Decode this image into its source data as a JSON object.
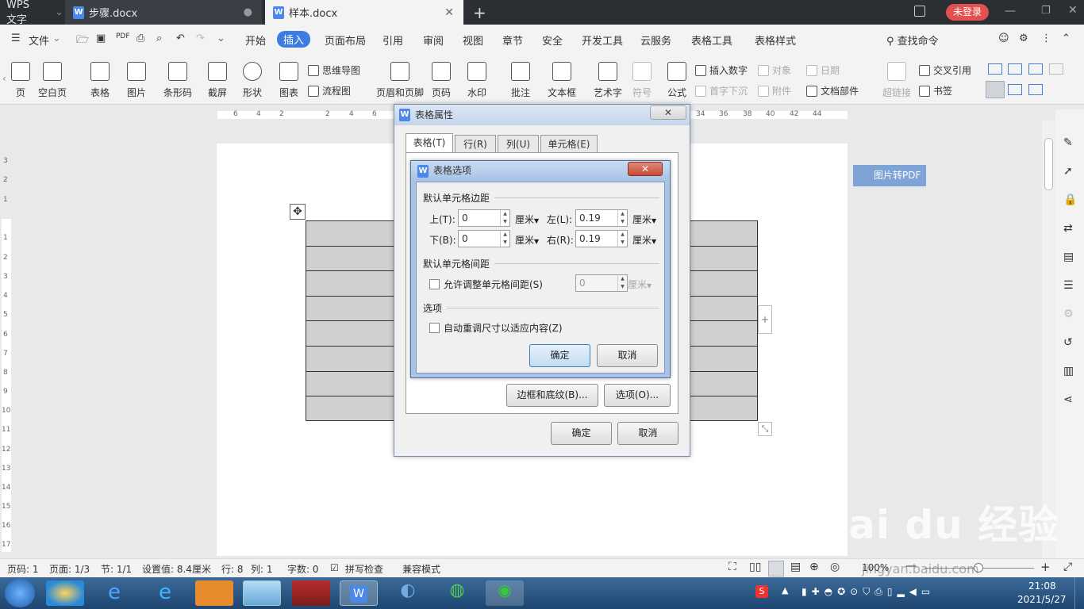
{
  "titlebar": {
    "app_tab": "WPS 文字",
    "doc1_tab": "步骤.docx",
    "doc2_tab": "样本.docx",
    "login": "未登录"
  },
  "menu": {
    "file": "文件",
    "items": [
      "开始",
      "插入",
      "页面布局",
      "引用",
      "审阅",
      "视图",
      "章节",
      "安全",
      "开发工具",
      "云服务",
      "表格工具",
      "表格样式"
    ],
    "search": "查找命令"
  },
  "ribbon": {
    "large": [
      "页",
      "空白页",
      "表格",
      "图片",
      "条形码",
      "截屏",
      "形状",
      "图表",
      "页眉和页脚",
      "页码",
      "水印",
      "批注",
      "文本框",
      "艺术字",
      "符号",
      "公式"
    ],
    "small": [
      "思维导图",
      "流程图",
      "插入数字",
      "对象",
      "日期",
      "首字下沉",
      "附件",
      "文档部件",
      "超链接",
      "交叉引用",
      "书签"
    ]
  },
  "ruler": {
    "h_ticks": [
      "6",
      "4",
      "2",
      "2",
      "4",
      "6",
      "34",
      "36",
      "38",
      "40",
      "42",
      "44"
    ],
    "v_ticks": [
      "3",
      "2",
      "1",
      "1",
      "2",
      "3",
      "4",
      "5",
      "6",
      "7",
      "8",
      "9",
      "10",
      "11",
      "12",
      "13",
      "14",
      "15",
      "16",
      "17"
    ]
  },
  "pdf_button": "图片转PDF",
  "outer_dialog": {
    "title": "表格属性",
    "tabs": [
      "表格(T)",
      "行(R)",
      "列(U)",
      "单元格(E)"
    ],
    "borders_button": "边框和底纹(B)...",
    "options_button": "选项(O)...",
    "ok": "确定",
    "cancel": "取消"
  },
  "inner_dialog": {
    "title": "表格选项",
    "section_margins": "默认单元格边距",
    "top_label": "上(T):",
    "top_value": "0",
    "bottom_label": "下(B):",
    "bottom_value": "0",
    "left_label": "左(L):",
    "left_value": "0.19",
    "right_label": "右(R):",
    "right_value": "0.19",
    "unit": "厘米",
    "section_spacing": "默认单元格间距",
    "allow_spacing": "允许调整单元格间距(S)",
    "spacing_value": "0",
    "section_options": "选项",
    "autofit": "自动重调尺寸以适应内容(Z)",
    "ok": "确定",
    "cancel": "取消"
  },
  "status": {
    "page": "页码: 1",
    "page_of": "页面: 1/3",
    "section": "节: 1/1",
    "setting": "设置值: 8.4厘米",
    "row": "行: 8",
    "col": "列: 1",
    "words": "字数: 0",
    "spellcheck": "拼写检查",
    "compat": "兼容模式",
    "zoom": "100%"
  },
  "clock": {
    "time": "21:08",
    "date": "2021/5/27"
  },
  "watermark": {
    "logo": "Bai du 经验",
    "url": "jingyan.baidu.com"
  }
}
